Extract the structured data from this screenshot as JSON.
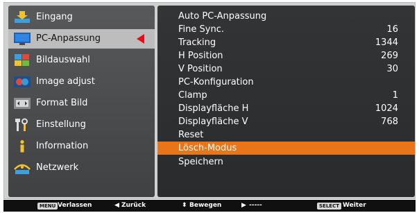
{
  "colors": {
    "left_panel": "#4a4b4d",
    "right_panel": "#2f3032",
    "selected_item_bg": "#bdbdbd",
    "selection_arrow": "#e3101a",
    "highlight_row": "#e8751a",
    "footer_bg": "#101010"
  },
  "sidebar": {
    "items": [
      {
        "label": "Eingang",
        "icon": "input-arrow-icon"
      },
      {
        "label": "PC-Anpassung",
        "icon": "pc-monitor-icon"
      },
      {
        "label": "Bildauswahl",
        "icon": "image-select-icon"
      },
      {
        "label": "Image adjust",
        "icon": "image-adjust-icon"
      },
      {
        "label": "Format Bild",
        "icon": "screen-format-icon"
      },
      {
        "label": "Einstellung",
        "icon": "settings-tools-icon"
      },
      {
        "label": "Information",
        "icon": "info-icon"
      },
      {
        "label": "Netzwerk",
        "icon": "network-icon"
      }
    ],
    "selected": "PC-Anpassung"
  },
  "main": {
    "rows": [
      {
        "label": "Auto PC-Anpassung",
        "value": ""
      },
      {
        "label": "Fine Sync.",
        "value": "16"
      },
      {
        "label": "Tracking",
        "value": "1344"
      },
      {
        "label": "H Position",
        "value": "269"
      },
      {
        "label": "V Position",
        "value": "30"
      },
      {
        "label": "PC-Konfiguration",
        "value": ""
      },
      {
        "label": "Clamp",
        "value": "1"
      },
      {
        "label": "Displayfläche H",
        "value": "1024"
      },
      {
        "label": "Displayfläche V",
        "value": "768"
      },
      {
        "label": "Reset",
        "value": ""
      },
      {
        "label": "Lösch-Modus",
        "value": ""
      },
      {
        "label": "Speichern",
        "value": ""
      }
    ],
    "highlighted": "Lösch-Modus"
  },
  "footer": {
    "menu_button": "MENU",
    "menu_text": "Verlassen",
    "back_text": "Zurück",
    "move_text": "Bewegen",
    "next_text": "-----",
    "select_button": "SELECT",
    "select_text": "Weiter"
  }
}
